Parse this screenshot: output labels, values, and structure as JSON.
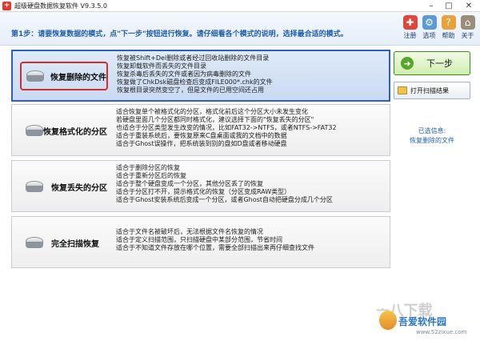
{
  "window": {
    "title": "超级硬盘数据恢复软件 V9.3.5.0",
    "min": "–",
    "max": "□",
    "close": "✕"
  },
  "header": {
    "step_text": "第1步：请要恢复数据的模式，点\"下一步\"按钮进行恢复。请仔细看各个模式的说明，选择最合适的模式。",
    "icons": [
      {
        "label": "注册",
        "icon": "register-icon",
        "color": "#e0463a"
      },
      {
        "label": "选项",
        "icon": "options-icon",
        "color": "#5a9ad6"
      },
      {
        "label": "帮助",
        "icon": "help-icon",
        "color": "#e7a33a"
      },
      {
        "label": "关于",
        "icon": "about-icon",
        "color": "#9a8e7a"
      }
    ]
  },
  "modes": [
    {
      "label": "恢复删除的文件",
      "selected": true,
      "desc": [
        "恢复被Shift+Del删除或者经过回收站删除的文件目录",
        "恢复卸载软件而丢失的文件目录",
        "恢复杀毒后丢失的文件或者因为病毒删除的文件",
        "恢复做了ChkDsk磁盘检查后变成FILE000*.chk的文件",
        "恢复根目录突然变空了，但是文件的已用空间还占用"
      ]
    },
    {
      "label": "恢复格式化的分区",
      "selected": false,
      "desc": [
        "适合恢复单个被格式化的分区，格式化前后这个分区大小未发生变化",
        "若硬盘里面几个分区都同时格式化，建议选择下面的\"恢复丢失的分区\"",
        "也适合于分区类型发生改变的情况，比如FAT32->NTFS，或者NTFS->FAT32",
        "适合于重装系统后，要恢复原来C盘桌面或我的文档中的数据",
        "适合于Ghost误操作，把系统装到别的盘如D盘或者移动硬盘"
      ]
    },
    {
      "label": "恢复丢失的分区",
      "selected": false,
      "desc": [
        "适合于删除分区的恢复",
        "适合于重新分区后的恢复",
        "适合于整个硬盘变成一个分区，其他分区丢了的恢复",
        "适合于分区打不开，提示格式化的恢复（分区变成RAW类型）",
        "适合于Ghost安装系统后变成一个分区，或者Ghost自动把硬盘分成几个分区"
      ]
    },
    {
      "label": "完全扫描恢复",
      "selected": false,
      "desc": [
        "适合于文件名被破坏后，无法根据文件名恢复的情况",
        "适合于定义扫描范围，只扫描硬盘中某部分范围，节省时间",
        "适合于不知道文件存放在哪个位置，需要全部扫描出来再仔细查找文件"
      ]
    }
  ],
  "actions": {
    "next_label": "下一步",
    "open_label": "打开扫描结果"
  },
  "selection": {
    "label": "已选信息:",
    "value": "恢复删除的文件"
  },
  "watermark": {
    "brand": "ᅩ八下载",
    "site": "吾爱软件园",
    "url": "www.52zixue.com"
  }
}
